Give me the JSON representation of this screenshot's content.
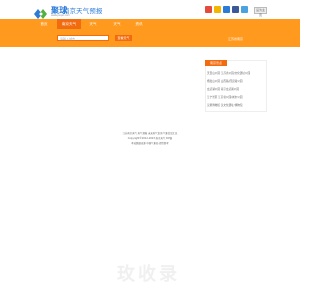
{
  "header": {
    "logo_text": "聚球",
    "logo_sub": "www.jiuqiu.com",
    "site_title": "南京天气预报",
    "button_label": "设为主页"
  },
  "nav": {
    "items": [
      {
        "label": "首页"
      },
      {
        "label": "南京天气"
      },
      {
        "label": "天气"
      },
      {
        "label": "天气"
      },
      {
        "label": "资讯"
      }
    ]
  },
  "search": {
    "placeholder": "请输入城市",
    "button_label": "查看天气",
    "right_link": "江苏省南京"
  },
  "panel": {
    "title": "南京景点",
    "rows": [
      "天目山公园    江苏省公园/文化遗址公园",
      "栖霞山公园    山西路/西安路公园",
      "玄武湖公园    南京玄武湖公园",
      "江宁景区      江苏省公园/城市公园",
      "汉墓博物馆    汉文化遗址/博物馆"
    ]
  },
  "footer": {
    "lines": [
      "江苏南京天气 天气预报 未来天气查询 气象信息汇总",
      "Copyright©2012-2023 南京天气 ICP备",
      "本站数据来源 中国气象局 提供参考"
    ]
  },
  "watermark": "玫收录",
  "colors": {
    "accent": "#f26b0f",
    "nav": "#ff9a1e",
    "brand_blue": "#2b7bd8"
  },
  "icons": [
    "weibo-icon",
    "qzone-icon",
    "rss-icon",
    "share-icon",
    "tencent-icon"
  ]
}
